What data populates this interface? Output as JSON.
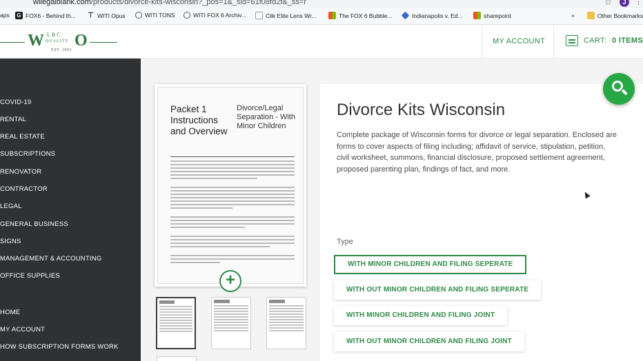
{
  "browser": {
    "url_prefix": "wilegalblank.com",
    "url_rest": "/products/divorce-kits-wisconsin?_pos=1&_sid=61f08fd2f&_ss=r",
    "profile_initial": "J",
    "bookmarks": [
      {
        "label": "aps",
        "icon": "apps-icon"
      },
      {
        "label": "FOX6 - Behind th...",
        "icon": "fox-icon"
      },
      {
        "label": "WITI Opus",
        "icon": "antenna-icon"
      },
      {
        "label": "WITI TONS",
        "icon": "globe-icon"
      },
      {
        "label": "WITI FOX 6 Archiv...",
        "icon": "globe-icon"
      },
      {
        "label": "Clik Elite Lens Wr...",
        "icon": "page-icon"
      },
      {
        "label": "The FOX 6 Bubble...",
        "icon": "windows-icon"
      },
      {
        "label": "Indianapolis v. Ed...",
        "icon": "diamond-icon"
      },
      {
        "label": "sharepoint",
        "icon": "windows-icon"
      }
    ],
    "overflow": "»",
    "other_bookmarks": "Other Bookmarks"
  },
  "header": {
    "logo": {
      "w": "W",
      "lbc": "LBC",
      "o": "O",
      "quality": "QUALITY",
      "est": "EST. 1903"
    },
    "my_account": "MY ACCOUNT",
    "cart_label": "CART:",
    "cart_count": "0 ITEMS"
  },
  "sidebar": {
    "categories": [
      "COVID-19",
      "RENTAL",
      "REAL ESTATE",
      "SUBSCRIPTIONS",
      "RENOVATOR",
      "CONTRACTOR",
      "LEGAL",
      "GENERAL BUSINESS",
      "SIGNS",
      "MANAGEMENT & ACCOUNTING",
      "OFFICE SUPPLIES"
    ],
    "links": [
      "HOME",
      "MY ACCOUNT",
      "HOW SUBSCRIPTION FORMS WORK"
    ]
  },
  "product": {
    "image": {
      "doc_title": "Packet 1 Instructions and Overview",
      "doc_side": "Divorce/Legal Separation - With Minor Children"
    },
    "title": "Divorce Kits Wisconsin",
    "description": "Complete package of Wisconsin forms for divorce or legal separation. Enclosed are forms to cover aspects of filing including; affidavit of service, stipulation, petition, civil worksheet, summons, financial disclosure, proposed settlement agreement, proposed parenting plan, findings of fact, and more.",
    "type_label": "Type",
    "options": [
      {
        "label": "WITH MINOR CHILDREN AND FILING SEPERATE",
        "selected": true
      },
      {
        "label": "WITH OUT MINOR CHILDREN AND FILING SEPERATE",
        "selected": false
      },
      {
        "label": "WITH MINOR CHILDREN AND FILING JOINT",
        "selected": false
      },
      {
        "label": "WITH OUT MINOR CHILDREN AND FILING JOINT",
        "selected": false
      }
    ]
  },
  "colors": {
    "accent": "#2d8a46",
    "sidebar": "#2f3133",
    "fab": "#28a745"
  }
}
